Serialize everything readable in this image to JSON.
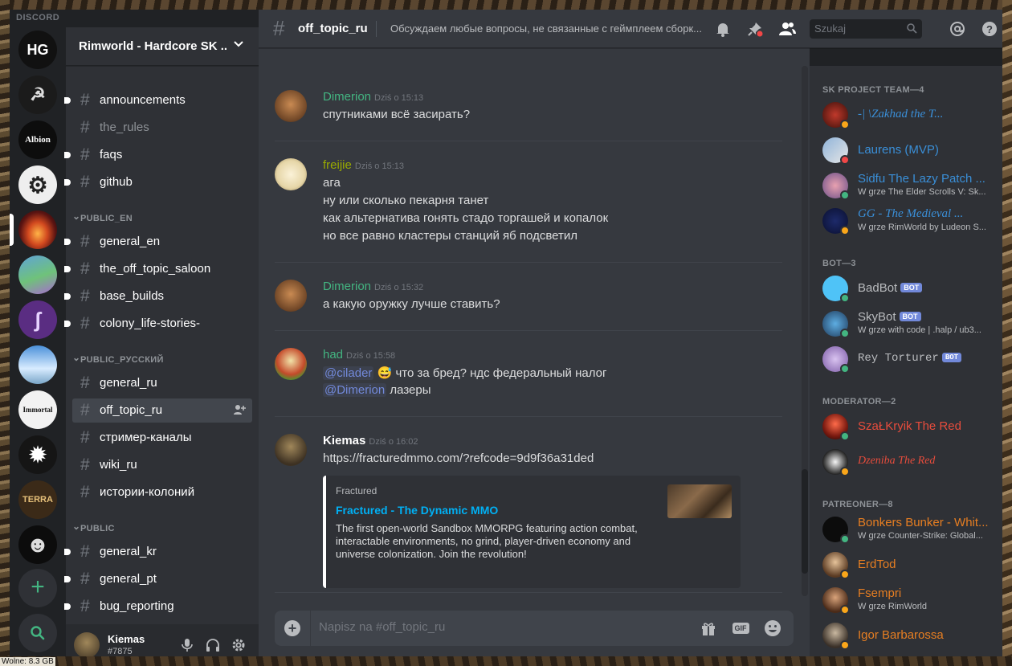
{
  "app": {
    "brand": "DISCORD",
    "window_controls": [
      "–",
      "☐",
      "✕"
    ]
  },
  "desktop": {
    "status_text": "Wolne: 8.3 GB"
  },
  "colors": {
    "accent": "#7289da",
    "online": "#43b581",
    "idle": "#faa61a",
    "dnd": "#f04747",
    "link": "#00b0f4",
    "sk_team": "#3a8fd8",
    "moderator": "#e74c3c",
    "patreoner": "#e67e22",
    "green_name": "#43b581",
    "olive_name": "#99aa00"
  },
  "servers": [
    {
      "label": "HG"
    },
    {
      "label": "☭"
    },
    {
      "label": "Albion"
    },
    {
      "label": "⚙"
    },
    {
      "label": ""
    },
    {
      "label": ""
    },
    {
      "label": "ʃ"
    },
    {
      "label": ""
    },
    {
      "label": "Immortal"
    },
    {
      "label": "✹"
    },
    {
      "label": "TERRA"
    },
    {
      "label": "☻"
    }
  ],
  "sidebar": {
    "guild_name": "Rimworld - Hardcore SK ...",
    "channels_top": [
      {
        "name": "announcements",
        "unread": true
      },
      {
        "name": "the_rules",
        "unread": false
      },
      {
        "name": "faqs",
        "unread": true
      },
      {
        "name": "github",
        "unread": true
      }
    ],
    "cat_en": "PUBLIC_EN",
    "channels_en": [
      {
        "name": "general_en"
      },
      {
        "name": "the_off_topic_saloon"
      },
      {
        "name": "base_builds"
      },
      {
        "name": "colony_life-stories-"
      }
    ],
    "cat_ru": "PUBLIC_РУССКИЙ",
    "channels_ru": [
      {
        "name": "general_ru"
      },
      {
        "name": "off_topic_ru"
      },
      {
        "name": "стример-каналы"
      },
      {
        "name": "wiki_ru"
      },
      {
        "name": "истории-колоний"
      }
    ],
    "cat_public": "PUBLIC",
    "channels_public": [
      {
        "name": "general_kr"
      },
      {
        "name": "general_pt"
      },
      {
        "name": "bug_reporting"
      }
    ],
    "user": {
      "name": "Kiemas",
      "tag": "#7875"
    }
  },
  "header": {
    "channel": "off_topic_ru",
    "topic": "Обсуждаем любые вопросы, не связанные с геймплеем сборк...",
    "search_placeholder": "Szukaj"
  },
  "messages": [
    {
      "author": "Dimerion",
      "time": "Dziś o 15:13",
      "lines": [
        "спутниками всё засирать?"
      ]
    },
    {
      "author": "freijie",
      "time": "Dziś o 15:13",
      "lines": [
        "ага",
        "ну или сколько пекарня танет",
        "как альтернатива гонять стадо торгашей и копалок",
        "но все равно кластеры станций яб подсветил"
      ]
    },
    {
      "author": "Dimerion",
      "time": "Dziś o 15:32",
      "lines": [
        "а какую оружку лучше ставить?"
      ]
    },
    {
      "author": "had",
      "time": "Dziś o 15:58",
      "mention1": "@cilader",
      "emoji": "😅",
      "text1": "что за бред? ндс федеральный налог",
      "mention2": "@Dimerion",
      "text2": "лазеры"
    },
    {
      "author": "Kiemas",
      "time": "Dziś o 16:02",
      "link": "https://fracturedmmo.com/?refcode=9d9f36a31ded",
      "embed": {
        "provider": "Fractured",
        "title": "Fractured - The Dynamic MMO",
        "description": "The first open-world Sandbox MMORPG featuring action combat, interactable environments, no grind, player-driven economy and universe colonization. Join the revolution!"
      }
    }
  ],
  "composer": {
    "placeholder": "Napisz na #off_topic_ru",
    "gif_label": "GIF"
  },
  "members": {
    "cat_sk": "SK PROJECT TEAM—4",
    "sk": [
      {
        "name": "-| \\Zakhad the T...",
        "activity": "",
        "status": "idle"
      },
      {
        "name": "Laurens (MVP)",
        "activity": "",
        "status": "dnd"
      },
      {
        "name": "Sidfu The Lazy Patch ...",
        "activity": "W grze The Elder Scrolls V: Sk...",
        "status": "online"
      },
      {
        "name": "GG - The Medieval ...",
        "activity": "W grze RimWorld by Ludeon S...",
        "status": "idle"
      }
    ],
    "cat_bot": "BOT—3",
    "bots": [
      {
        "name": "BadBot",
        "badge": "BOT",
        "activity": "",
        "status": "online"
      },
      {
        "name": "SkyBot",
        "badge": "BOT",
        "activity": "W grze with code | .halp / ub3...",
        "status": "online"
      },
      {
        "name": "Rey Torturer",
        "badge": "BOT",
        "activity": "",
        "status": "online"
      }
    ],
    "cat_mod": "MODERATOR—2",
    "mods": [
      {
        "name": "SzaŁKryik The Red",
        "activity": "",
        "status": "online"
      },
      {
        "name": "Dzeniba The Red",
        "activity": "",
        "status": "idle"
      }
    ],
    "cat_pat": "PATREONER—8",
    "patrons": [
      {
        "name": "Bonkers Bunker - Whit...",
        "activity": "W grze Counter-Strike: Global...",
        "status": "online"
      },
      {
        "name": "ErdTod",
        "activity": "",
        "status": "idle"
      },
      {
        "name": "Fsempri",
        "activity": "W grze RimWorld",
        "status": "idle"
      },
      {
        "name": "Igor Barbarossa",
        "activity": "",
        "status": "idle"
      }
    ]
  }
}
